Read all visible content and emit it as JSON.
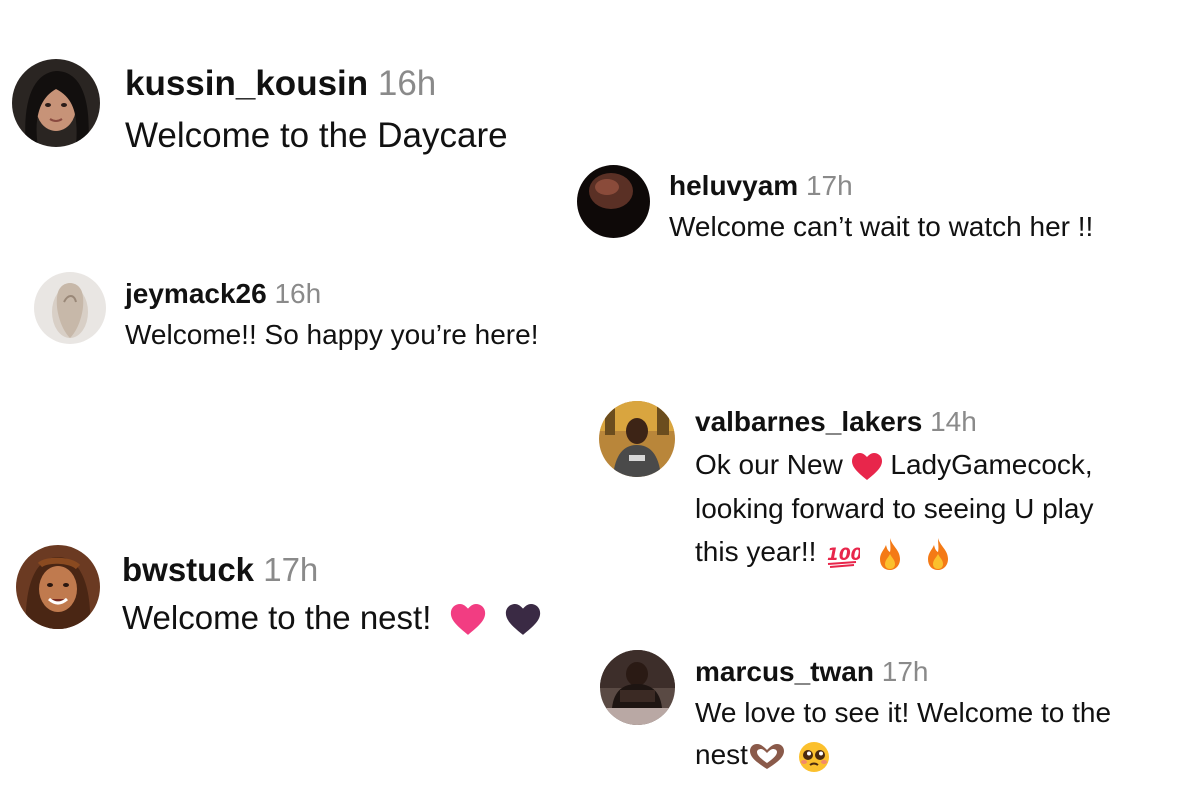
{
  "comments": [
    {
      "username": "kussin_kousin",
      "time": "16h",
      "text": "Welcome to the Daycare",
      "avatar_icon": "profile-photo-dark-hair"
    },
    {
      "username": "heluvyam",
      "time": "17h",
      "text": "Welcome can’t wait to watch her !!",
      "avatar_icon": "profile-photo-dark"
    },
    {
      "username": "jeymack26",
      "time": "16h",
      "text": "Welcome!! So happy you’re here!",
      "avatar_icon": "profile-photo-light"
    },
    {
      "username": "valbarnes_lakers",
      "time": "14h",
      "text_line1": "Ok our New",
      "text_line1b": "LadyGamecock,",
      "text_line2": "looking forward to seeing U play",
      "text_line3": "this year!!",
      "avatar_icon": "profile-photo-court",
      "emojis": [
        "red-heart-icon",
        "hundred-points-icon",
        "fire-icon",
        "fire-icon"
      ]
    },
    {
      "username": "bwstuck",
      "time": "17h",
      "text": "Welcome to the nest!",
      "avatar_icon": "profile-photo-smiling",
      "emojis": [
        "pink-heart-icon",
        "purple-heart-icon"
      ]
    },
    {
      "username": "marcus_twan",
      "time": "17h",
      "text_line1": "We love to see it! Welcome to the",
      "text_line2": "nest",
      "avatar_icon": "profile-photo-gym",
      "emojis": [
        "heart-hands-icon",
        "pleading-face-icon"
      ]
    }
  ],
  "colors": {
    "username": "#111111",
    "timestamp": "#8a8a8a",
    "text": "#111111",
    "red_heart": "#e8264b",
    "pink_heart": "#f23d82",
    "purple_heart": "#3a2a44",
    "fire": "#f47a16"
  }
}
